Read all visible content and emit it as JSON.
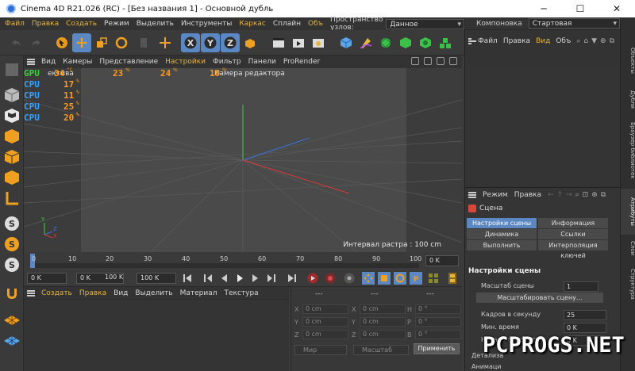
{
  "window": {
    "title": "Cinema 4D R21.026 (RC) - [Без названия 1] - Основной дубль",
    "minimize": "─",
    "maximize": "☐",
    "close": "✕"
  },
  "menubar": {
    "items": [
      {
        "label": "Файл",
        "highlight": true
      },
      {
        "label": "Правка",
        "highlight": true
      },
      {
        "label": "Создать",
        "highlight": true
      },
      {
        "label": "Режим",
        "highlight": false
      },
      {
        "label": "Выделить",
        "highlight": false
      },
      {
        "label": "Инструменты",
        "highlight": false
      },
      {
        "label": "Каркас",
        "highlight": true
      },
      {
        "label": "Сплайн",
        "highlight": false
      },
      {
        "label": "Объ",
        "highlight": true
      }
    ],
    "nodespace_label": "Пространство узлов:",
    "nodespace_value": "Данное (Стандартный/Физический)"
  },
  "viewport": {
    "menu": [
      {
        "label": "Вид",
        "highlight": false
      },
      {
        "label": "Камеры",
        "highlight": false
      },
      {
        "label": "Представление",
        "highlight": false
      },
      {
        "label": "Настройки",
        "highlight": true
      },
      {
        "label": "Фильтр",
        "highlight": false
      },
      {
        "label": "Панели",
        "highlight": false
      },
      {
        "label": "ProRender",
        "highlight": false
      }
    ],
    "camera_label": "Камера редактора",
    "persp_fragment": "ектива",
    "status": "Интервал растра : 100 cm",
    "axis_labels": {
      "y": "Y",
      "z": "Z",
      "x": "X"
    }
  },
  "hwmon": [
    {
      "name": "GPU",
      "value": "34",
      "unit": "°C",
      "extra1": "23",
      "extra1_unit": "%",
      "extra2": "24",
      "extra2_unit": "%",
      "extra3": "10",
      "extra3_unit": "%"
    },
    {
      "name": "CPU",
      "value": "17",
      "unit": "%"
    },
    {
      "name": "CPU",
      "value": "11",
      "unit": "%"
    },
    {
      "name": "CPU",
      "value": "25",
      "unit": "%"
    },
    {
      "name": "CPU",
      "value": "20",
      "unit": "%"
    }
  ],
  "timeline": {
    "ticks": [
      "0",
      "10",
      "20",
      "30",
      "40",
      "50",
      "60",
      "70",
      "80",
      "90",
      "100"
    ],
    "frame_end": "0 K"
  },
  "transport": {
    "start": "0 K",
    "min": "0 K",
    "max": "100 K",
    "end": "100 K"
  },
  "material": {
    "menu": [
      {
        "label": "Создать",
        "highlight": true
      },
      {
        "label": "Правка",
        "highlight": true
      },
      {
        "label": "Вид",
        "highlight": false
      },
      {
        "label": "Выделить",
        "highlight": false
      },
      {
        "label": "Материал",
        "highlight": false
      },
      {
        "label": "Текстура",
        "highlight": false
      }
    ]
  },
  "coords": {
    "headers": [
      "---",
      "---",
      "---"
    ],
    "rows": [
      {
        "a": "X",
        "av": "0 cm",
        "b": "X",
        "bv": "0 cm",
        "c": "H",
        "cv": "0 °"
      },
      {
        "a": "Y",
        "av": "0 cm",
        "b": "Y",
        "bv": "0 cm",
        "c": "P",
        "cv": "0 °"
      },
      {
        "a": "Z",
        "av": "0 cm",
        "b": "Z",
        "bv": "0 cm",
        "c": "B",
        "cv": "0 °"
      }
    ],
    "space": "Мир",
    "scale": "Масштаб",
    "apply": "Применить"
  },
  "right": {
    "layout_label": "Компоновка",
    "layout_value": "Стартовая",
    "objmenu": [
      {
        "label": "Файл",
        "highlight": false
      },
      {
        "label": "Правка",
        "highlight": false
      },
      {
        "label": "Вид",
        "highlight": true
      },
      {
        "label": "Объ",
        "highlight": false
      }
    ],
    "attr_menu": [
      "Режим",
      "Правка"
    ],
    "scene_label": "Сцена",
    "tabs": [
      "Настройки сцены",
      "Информация",
      "Динамика",
      "Ссылки",
      "Выполнить",
      "Интерполяция ключей"
    ],
    "section": "Настройки сцены",
    "scale_label": "Масштаб сцены",
    "scale_value": "1",
    "scale_btn": "Масштабировать сцену...",
    "fps_label": "Кадров в секунду",
    "fps_value": "25",
    "mintime_label": "Мин. время",
    "mintime_value": "0 K",
    "preview_label": "Начало просмотра",
    "preview_value": "0 K",
    "detail_label": "Детализа",
    "anim_label": "Анимаци"
  },
  "vtabs": [
    "Объекты",
    "Дубли",
    "Браузер библиотек",
    "Атрибуты",
    "Слои",
    "Структура"
  ],
  "watermark": "PCPROGS.NET",
  "colors": {
    "accent": "#5b87c3",
    "highlight_text": "#e8b53a",
    "gpu": "#3cd23c",
    "cpu": "#3aa0ff",
    "value": "#ff9a1a"
  }
}
